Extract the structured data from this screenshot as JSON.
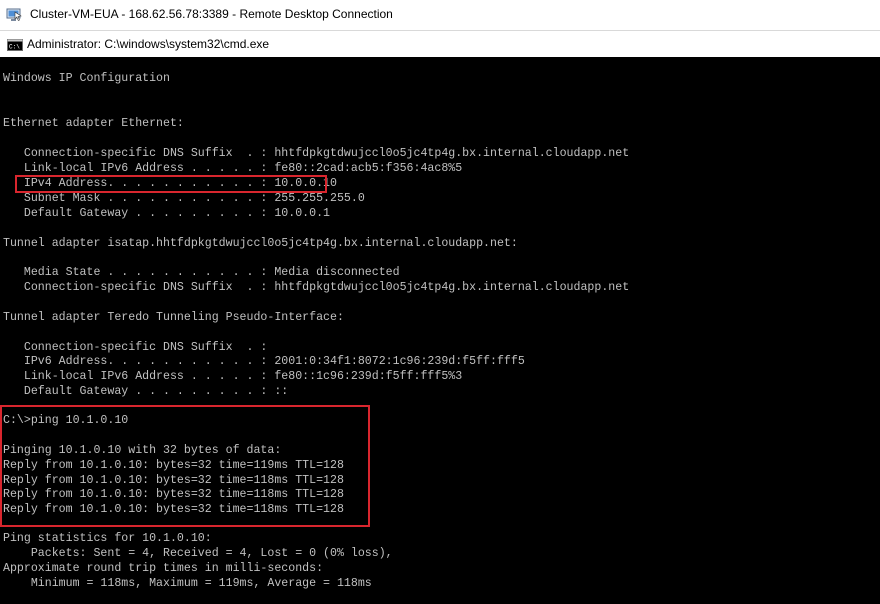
{
  "rdp_window": {
    "title": "Cluster-VM-EUA - 168.62.56.78:3389 - Remote Desktop Connection",
    "icon": "remote-desktop-icon"
  },
  "cmd_window": {
    "title": "Administrator: C:\\windows\\system32\\cmd.exe",
    "icon": "command-prompt-icon"
  },
  "colors": {
    "console_background": "#000000",
    "console_text": "#c0c0c0",
    "highlight_border": "#d9262e"
  },
  "console": {
    "lines": [
      "Windows IP Configuration",
      "",
      "",
      "Ethernet adapter Ethernet:",
      "",
      "   Connection-specific DNS Suffix  . : hhtfdpkgtdwujccl0o5jc4tp4g.bx.internal.cloudapp.net",
      "   Link-local IPv6 Address . . . . . : fe80::2cad:acb5:f356:4ac8%5",
      "   IPv4 Address. . . . . . . . . . . : 10.0.0.10",
      "   Subnet Mask . . . . . . . . . . . : 255.255.255.0",
      "   Default Gateway . . . . . . . . . : 10.0.0.1",
      "",
      "Tunnel adapter isatap.hhtfdpkgtdwujccl0o5jc4tp4g.bx.internal.cloudapp.net:",
      "",
      "   Media State . . . . . . . . . . . : Media disconnected",
      "   Connection-specific DNS Suffix  . : hhtfdpkgtdwujccl0o5jc4tp4g.bx.internal.cloudapp.net",
      "",
      "Tunnel adapter Teredo Tunneling Pseudo-Interface:",
      "",
      "   Connection-specific DNS Suffix  . :",
      "   IPv6 Address. . . . . . . . . . . : 2001:0:34f1:8072:1c96:239d:f5ff:fff5",
      "   Link-local IPv6 Address . . . . . : fe80::1c96:239d:f5ff:fff5%3",
      "   Default Gateway . . . . . . . . . : ::",
      "",
      "C:\\>ping 10.1.0.10",
      "",
      "Pinging 10.1.0.10 with 32 bytes of data:",
      "Reply from 10.1.0.10: bytes=32 time=119ms TTL=128",
      "Reply from 10.1.0.10: bytes=32 time=118ms TTL=128",
      "Reply from 10.1.0.10: bytes=32 time=118ms TTL=128",
      "Reply from 10.1.0.10: bytes=32 time=118ms TTL=128",
      "",
      "Ping statistics for 10.1.0.10:",
      "    Packets: Sent = 4, Received = 4, Lost = 0 (0% loss),",
      "Approximate round trip times in milli-seconds:",
      "    Minimum = 118ms, Maximum = 119ms, Average = 118ms"
    ]
  }
}
